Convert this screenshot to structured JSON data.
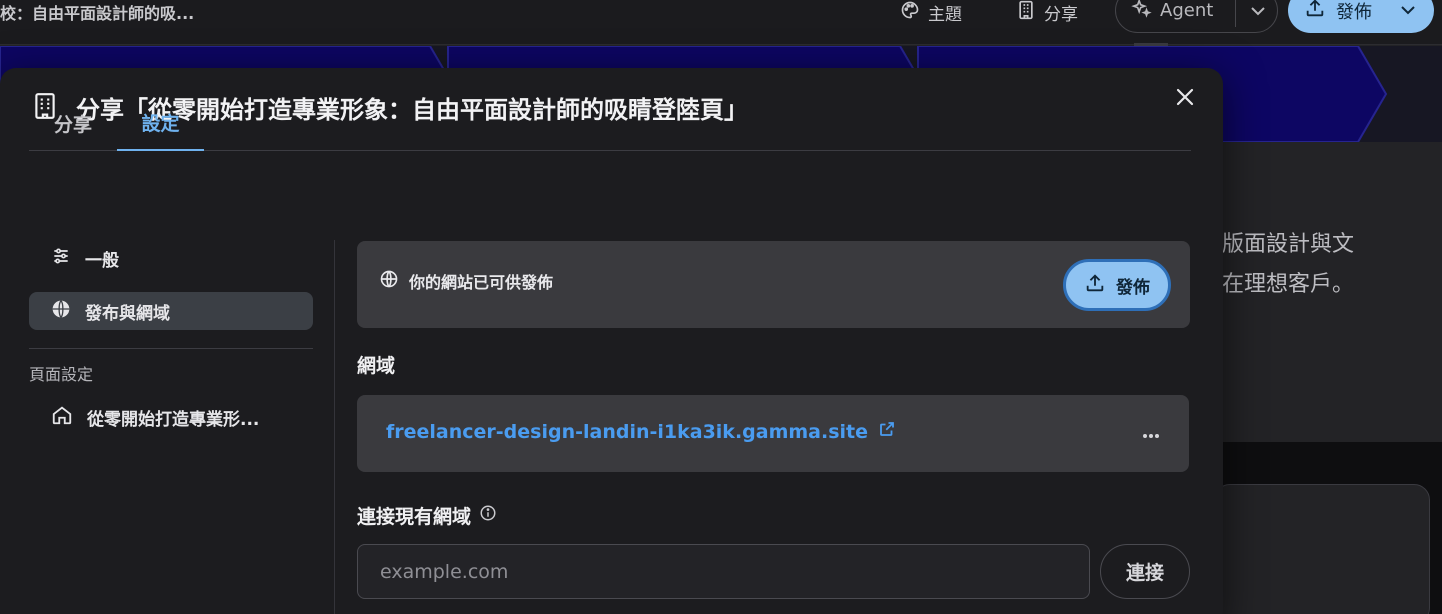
{
  "app": {
    "doc_title": "校：自由平面設計師的吸...",
    "theme_label": "主題",
    "share_label": "分享",
    "agent_label": "Agent",
    "publish_label": "發佈",
    "accent_color": "#8fc3f2",
    "canvas_text_line1": "版面設計與文",
    "canvas_text_line2": "在理想客戶。"
  },
  "modal": {
    "title": "分享「從零開始打造專業形象：自由平面設計師的吸睛登陸頁」",
    "tabs": [
      {
        "label": "分享",
        "active": false
      },
      {
        "label": "設定",
        "active": true
      }
    ],
    "sidebar": {
      "items": [
        {
          "label": "一般",
          "icon": "sliders-icon",
          "active": false
        },
        {
          "label": "發布與網域",
          "icon": "globe-icon",
          "active": true
        }
      ],
      "section_title": "頁面設定",
      "page_item": {
        "label": "從零開始打造專業形...",
        "icon": "home-icon"
      }
    },
    "publish_card": {
      "message": "你的網站已可供發佈",
      "button_label": "發佈"
    },
    "domain": {
      "heading": "網域",
      "url": "freelancer-design-landin-i1ka3ik.gamma.site",
      "more_label": "···"
    },
    "custom_domain": {
      "heading": "連接現有網域",
      "placeholder": "example.com",
      "value": "",
      "connect_label": "連接"
    }
  }
}
